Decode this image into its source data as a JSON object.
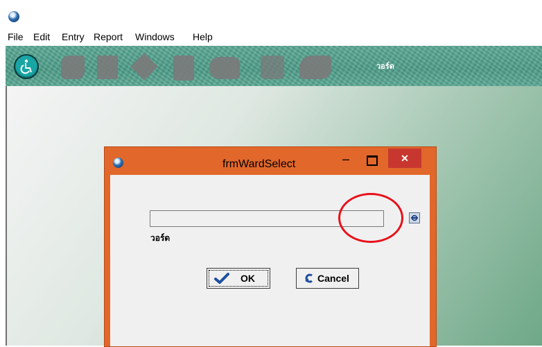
{
  "menu": [
    "File",
    "Edit",
    "Entry",
    "Report",
    "Windows",
    "Help"
  ],
  "toolbar": {
    "label": "วอร์ด"
  },
  "dialog": {
    "title": "frmWardSelect",
    "close_glyph": "✕",
    "minimize_glyph": "–",
    "field_value": "",
    "field_label": "วอร์ด",
    "ok_label": "OK",
    "cancel_label": "Cancel"
  },
  "colors": {
    "dialog_frame": "#e2672b",
    "close_button": "#c7372f",
    "toolbar": "#5aa894",
    "highlight": "#e8101a"
  },
  "icons": [
    "app-icon",
    "wheelchair-icon",
    "search-icon",
    "checkmark-icon",
    "cancel-arrow-icon"
  ]
}
